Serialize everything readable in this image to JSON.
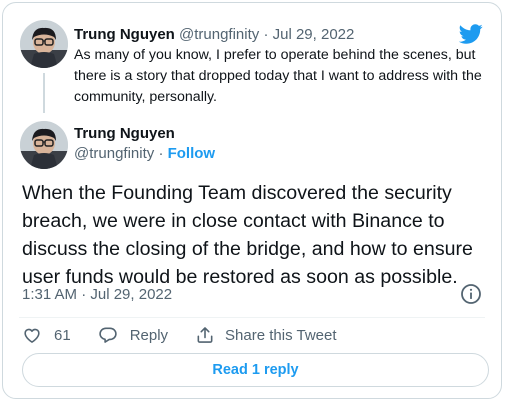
{
  "colors": {
    "accent": "#1d9bf0",
    "text": "#0f1419",
    "muted": "#536471",
    "border": "#cfd9de"
  },
  "icons": {
    "brand": "twitter-bird-icon",
    "info": "info-icon",
    "like": "heart-icon",
    "reply": "speech-bubble-icon",
    "share": "upload-arrow-icon"
  },
  "parent_tweet": {
    "display_name": "Trung Nguyen",
    "handle": "@trungfinity",
    "separator": "·",
    "date": "Jul 29, 2022",
    "text": "As many of you know, I prefer to operate behind the scenes, but there is a story that dropped today that I want to address with the community, personally."
  },
  "main_tweet": {
    "display_name": "Trung Nguyen",
    "handle": "@trungfinity",
    "separator": "·",
    "follow_label": "Follow",
    "text": "When the Founding Team discovered the security breach, we were in close contact with Binance to discuss the closing of the bridge, and how to ensure user funds would be restored as soon as possible.",
    "timestamp": "1:31 AM · Jul 29, 2022"
  },
  "actions": {
    "like_count": "61",
    "reply_label": "Reply",
    "share_label": "Share this Tweet"
  },
  "read_replies_label": "Read 1 reply"
}
